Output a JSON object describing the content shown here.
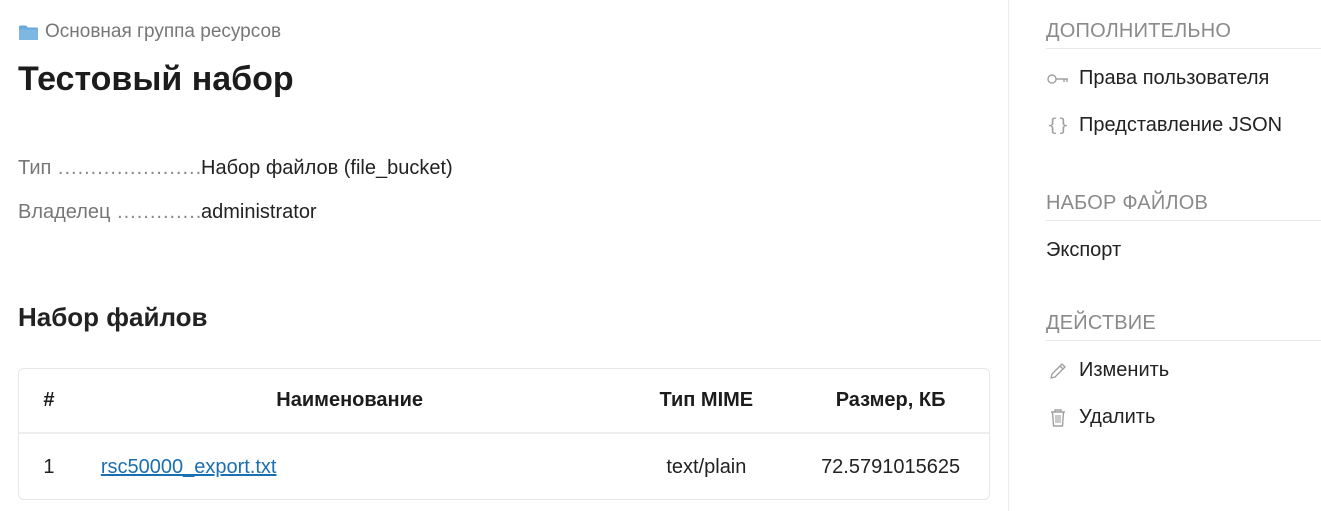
{
  "breadcrumb": {
    "label": "Основная группа ресурсов",
    "icon": "folder-icon"
  },
  "title": "Тестовый набор",
  "properties": [
    {
      "key": "Тип",
      "value": "Набор файлов (file_bucket)"
    },
    {
      "key": "Владелец",
      "value": "administrator"
    }
  ],
  "section_title": "Набор файлов",
  "table": {
    "headers": [
      "#",
      "Наименование",
      "Тип MIME",
      "Размер, КБ"
    ],
    "rows": [
      {
        "num": "1",
        "name": "rsc50000_export.txt",
        "mime": "text/plain",
        "size": "72.5791015625"
      }
    ]
  },
  "sidebar": {
    "extra": {
      "heading": "ДОПОЛНИТЕЛЬНО",
      "items": [
        {
          "label": "Права пользователя",
          "icon": "key-icon"
        },
        {
          "label": "Представление JSON",
          "icon": "braces-icon"
        }
      ]
    },
    "bucket": {
      "heading": "НАБОР ФАЙЛОВ",
      "items": [
        {
          "label": "Экспорт"
        }
      ]
    },
    "action": {
      "heading": "ДЕЙСТВИЕ",
      "items": [
        {
          "label": "Изменить",
          "icon": "pencil-icon"
        },
        {
          "label": "Удалить",
          "icon": "trash-icon"
        }
      ]
    }
  },
  "colors": {
    "link": "#1a6fb3",
    "folder": "#6aa9dc",
    "muted_text": "#777777",
    "icon_gray": "#9a9a9a"
  }
}
